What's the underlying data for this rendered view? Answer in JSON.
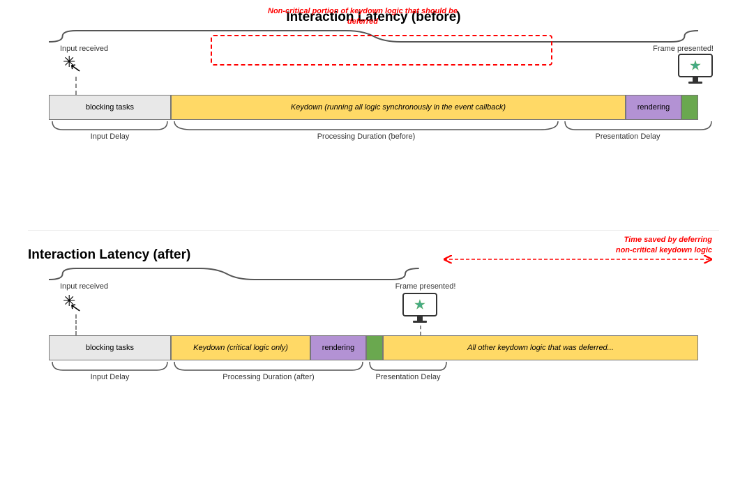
{
  "top": {
    "title": "Interaction Latency (before)",
    "input_received": "Input received",
    "frame_presented": "Frame presented!",
    "annotation_text": "Non-critical portion of keydown\nlogic that should be deferred",
    "bar_blocking": "blocking tasks",
    "bar_keydown": "Keydown (running all logic synchronously in the event callback)",
    "bar_rendering": "rendering",
    "label_input_delay": "Input Delay",
    "label_processing": "Processing Duration (before)",
    "label_presentation": "Presentation Delay"
  },
  "bottom": {
    "title": "Interaction Latency (after)",
    "input_received": "Input received",
    "frame_presented": "Frame presented!",
    "time_saved_line1": "Time saved by deferring",
    "time_saved_line2": "non-critical keydown logic",
    "bar_blocking": "blocking tasks",
    "bar_keydown": "Keydown (critical logic only)",
    "bar_rendering": "rendering",
    "bar_deferred": "All other keydown logic that was deferred...",
    "label_input_delay": "Input Delay",
    "label_processing": "Processing Duration (after)",
    "label_presentation": "Presentation Delay"
  }
}
